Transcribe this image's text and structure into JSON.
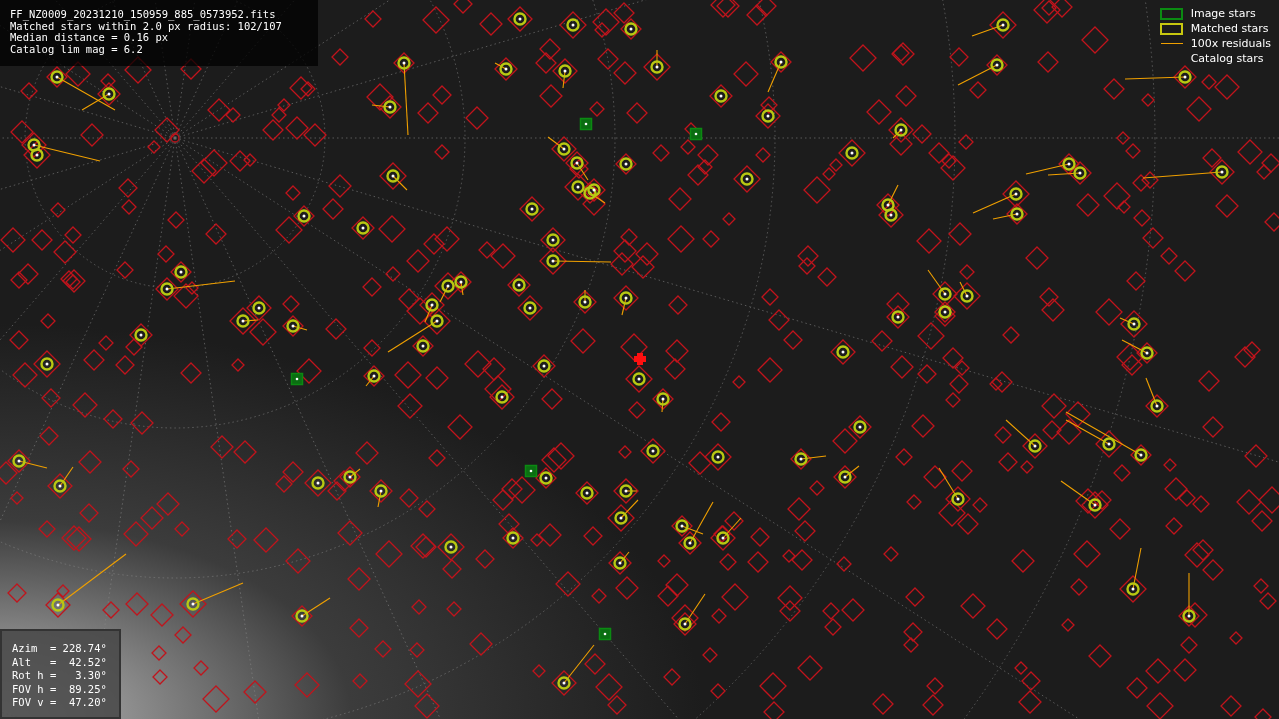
{
  "info_panel": {
    "lines": [
      "FF_NZ0009_20231210_150959_885_0573952.fits",
      "Matched stars within 2.0 px radius: 102/107",
      "Median distance = 0.16 px",
      "Catalog lim mag = 6.2"
    ]
  },
  "legend": [
    {
      "kind": "image",
      "label": "Image stars"
    },
    {
      "kind": "matched",
      "label": "Matched stars"
    },
    {
      "kind": "residual",
      "label": "100x residuals"
    },
    {
      "kind": "catalog",
      "label": "Catalog stars"
    }
  ],
  "pointing_panel": {
    "lines": [
      "Azim  = 228.74°",
      "Alt   =  42.52°",
      "Rot h =   3.30°",
      "FOV h =  89.25°",
      "FOV v =  47.20°"
    ]
  }
}
